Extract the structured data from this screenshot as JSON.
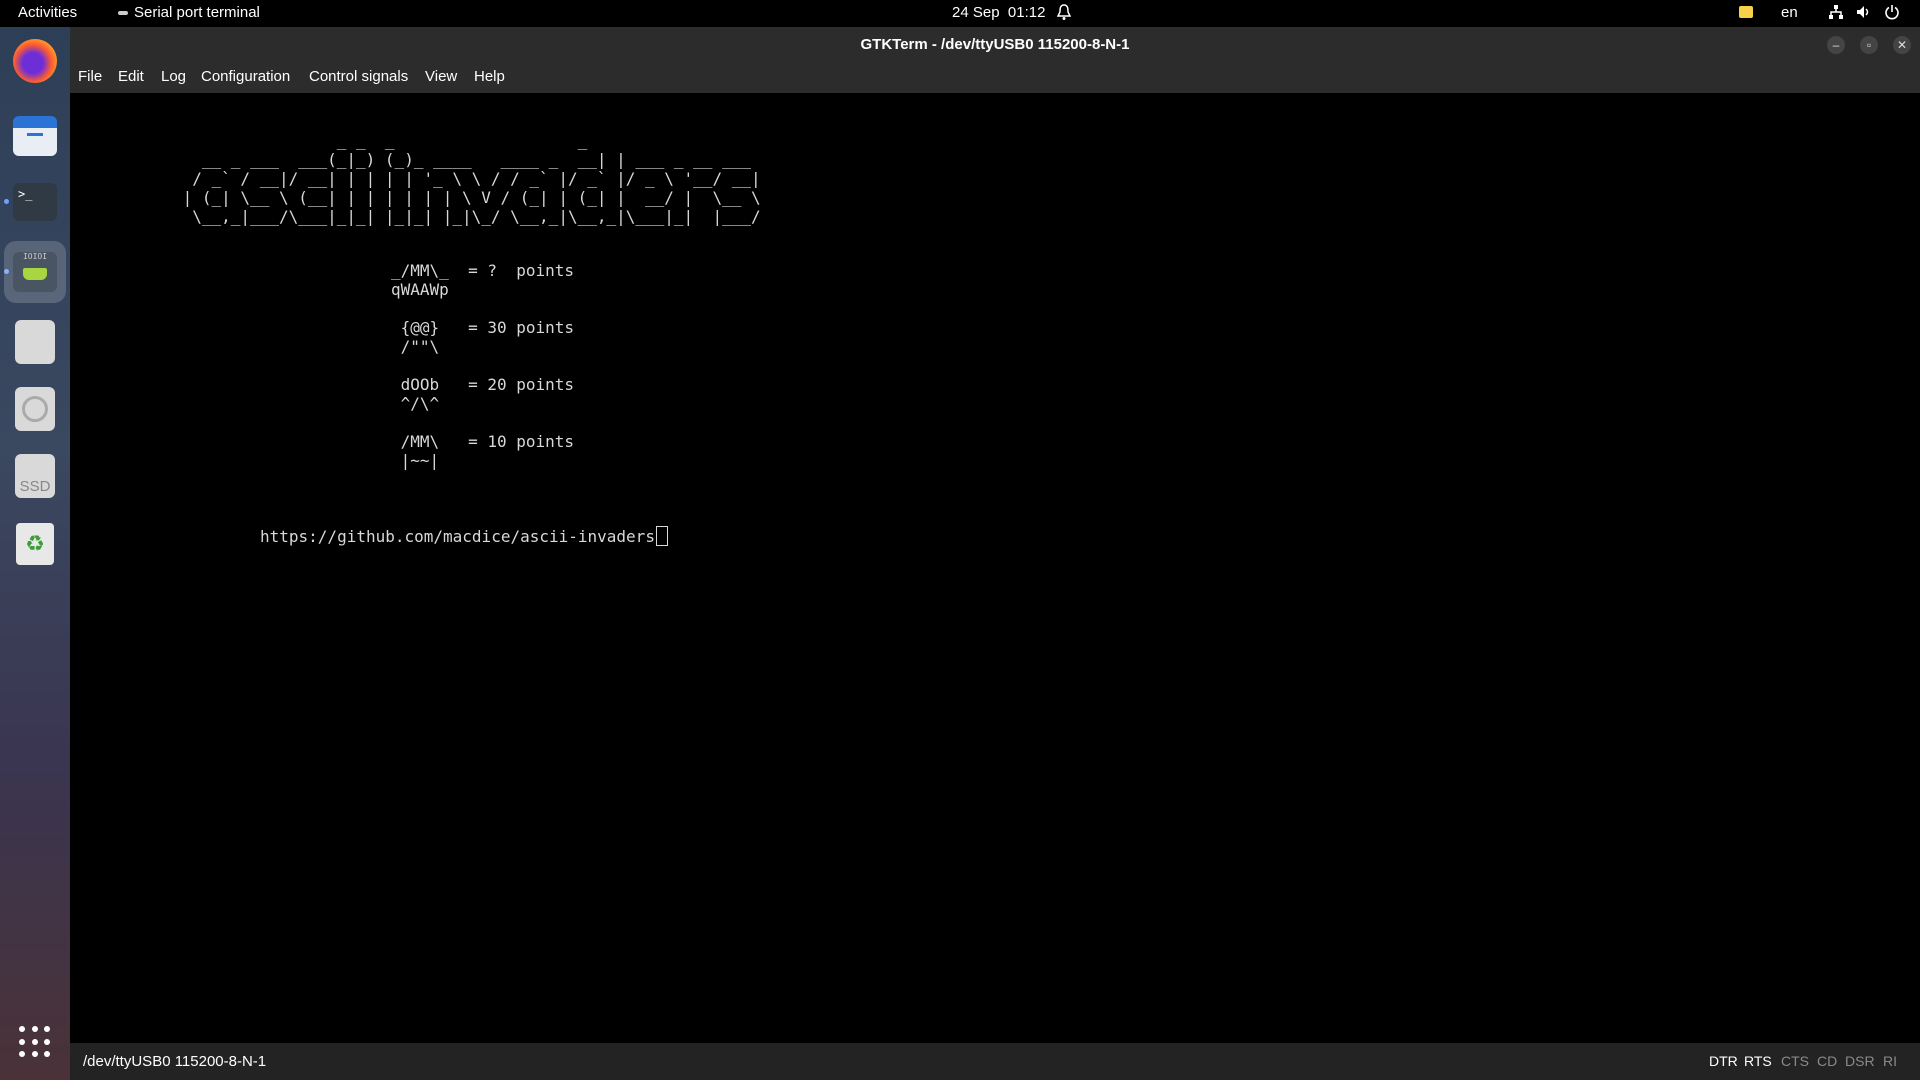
{
  "topbar": {
    "activities": "Activities",
    "app_name": "Serial port terminal",
    "date": "24 Sep",
    "time": "01:12",
    "language": "en"
  },
  "dock": {
    "items": [
      "firefox-icon",
      "files-icon",
      "terminal-icon",
      "serial-port-icon",
      "disk-icon",
      "cd-icon",
      "ssd-icon",
      "trash-icon",
      "app-grid-icon"
    ],
    "ssd_label": "SSD",
    "terminal_glyph": ">_",
    "serial_glyph": "IOIOI"
  },
  "window": {
    "title": "GTKTerm - /dev/ttyUSB0  115200-8-N-1",
    "menu": [
      "File",
      "Edit",
      "Log",
      "Configuration",
      "Control signals",
      "View",
      "Help"
    ]
  },
  "terminal": {
    "logo": "                 _ _  _                   _\n   __ _ ___  ___(_|_) (_)_ ____   ____ _  __| | ___ _ __ ___\n  / _` / __|/ __| | | | | '_ \\ \\ / / _` |/ _` |/ _ \\ '__/ __|\n | (_| \\__ \\ (__| | | | | | | \\ V / (_| | (_| |  __/ |  \\__ \\\n  \\__,_|___/\\___|_|_| |_|_| |_|\\_/ \\__,_|\\__,_|\\___|_|  |___/",
    "scores": "_/MM\\_  = ?  points\nqWAAWp\n\n {@@}   = 30 points\n /\"\"\\\n\n dOOb   = 20 points\n ^/\\^\n\n /MM\\   = 10 points\n |~~|",
    "url": "https://github.com/macdice/ascii-invaders"
  },
  "statusbar": {
    "port": "/dev/ttyUSB0  115200-8-N-1",
    "signals": [
      {
        "label": "DTR",
        "active": true
      },
      {
        "label": "RTS",
        "active": true
      },
      {
        "label": "CTS",
        "active": false
      },
      {
        "label": "CD",
        "active": false
      },
      {
        "label": "DSR",
        "active": false
      },
      {
        "label": "RI",
        "active": false
      }
    ]
  },
  "colors": {
    "terminal_bg": "#000000",
    "terminal_fg": "#d8d8d8",
    "titlebar_bg": "#2c2c2c",
    "signal_active": "#ffffff",
    "signal_inactive": "#8a8a8a"
  }
}
